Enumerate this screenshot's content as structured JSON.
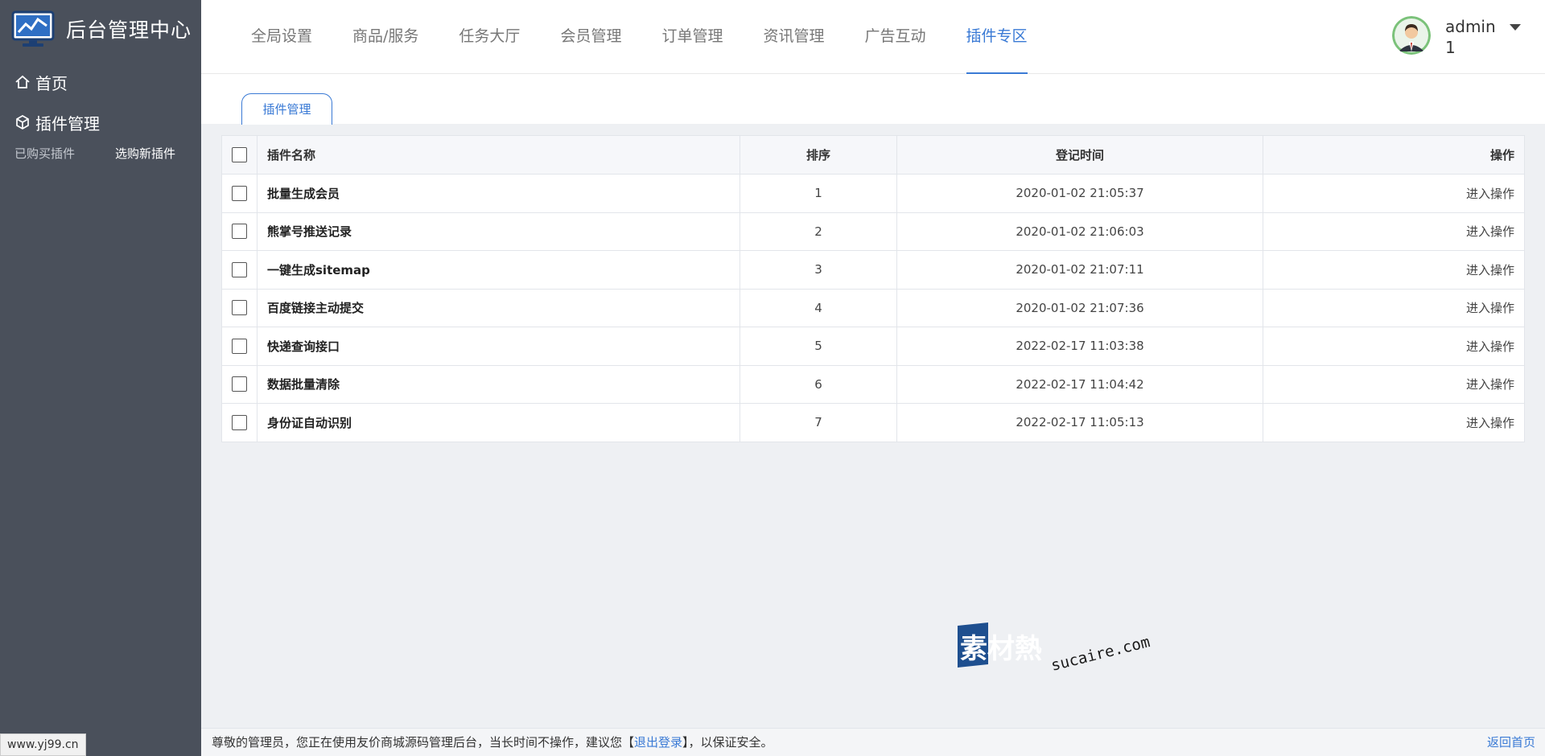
{
  "brand": {
    "title": "后台管理中心"
  },
  "sidebar": {
    "home_label": "首页",
    "plugin_label": "插件管理",
    "sub_items": [
      "已购买插件",
      "选购新插件"
    ]
  },
  "topnav": {
    "items": [
      "全局设置",
      "商品/服务",
      "任务大厅",
      "会员管理",
      "订单管理",
      "资讯管理",
      "广告互动",
      "插件专区"
    ],
    "active_index": 7
  },
  "user": {
    "name": "admin 1"
  },
  "tab": {
    "label": "插件管理"
  },
  "table": {
    "headers": [
      "插件名称",
      "排序",
      "登记时间",
      "操作"
    ],
    "rows": [
      {
        "name": "批量生成会员",
        "sort": "1",
        "time": "2020-01-02 21:05:37",
        "op": "进入操作"
      },
      {
        "name": "熊掌号推送记录",
        "sort": "2",
        "time": "2020-01-02 21:06:03",
        "op": "进入操作"
      },
      {
        "name": "一键生成sitemap",
        "sort": "3",
        "time": "2020-01-02 21:07:11",
        "op": "进入操作"
      },
      {
        "name": "百度链接主动提交",
        "sort": "4",
        "time": "2020-01-02 21:07:36",
        "op": "进入操作"
      },
      {
        "name": "快递查询接口",
        "sort": "5",
        "time": "2022-02-17 11:03:38",
        "op": "进入操作"
      },
      {
        "name": "数据批量清除",
        "sort": "6",
        "time": "2022-02-17 11:04:42",
        "op": "进入操作"
      },
      {
        "name": "身份证自动识别",
        "sort": "7",
        "time": "2022-02-17 11:05:13",
        "op": "进入操作"
      }
    ]
  },
  "watermark": {
    "cn": "素材熱",
    "en": "sucaire.com"
  },
  "footer": {
    "text_before": "尊敬的管理员，您正在使用友价商城源码管理后台，当长时间不操作，建议您【",
    "logout_link": "退出登录",
    "text_after": "】，以保证安全。",
    "back_link": "返回首页"
  },
  "site_tag": "www.yj99.cn",
  "colors": {
    "accent": "#3a7ad5",
    "sidebar_bg": "#4a505b",
    "page_bg": "#eef0f3"
  }
}
